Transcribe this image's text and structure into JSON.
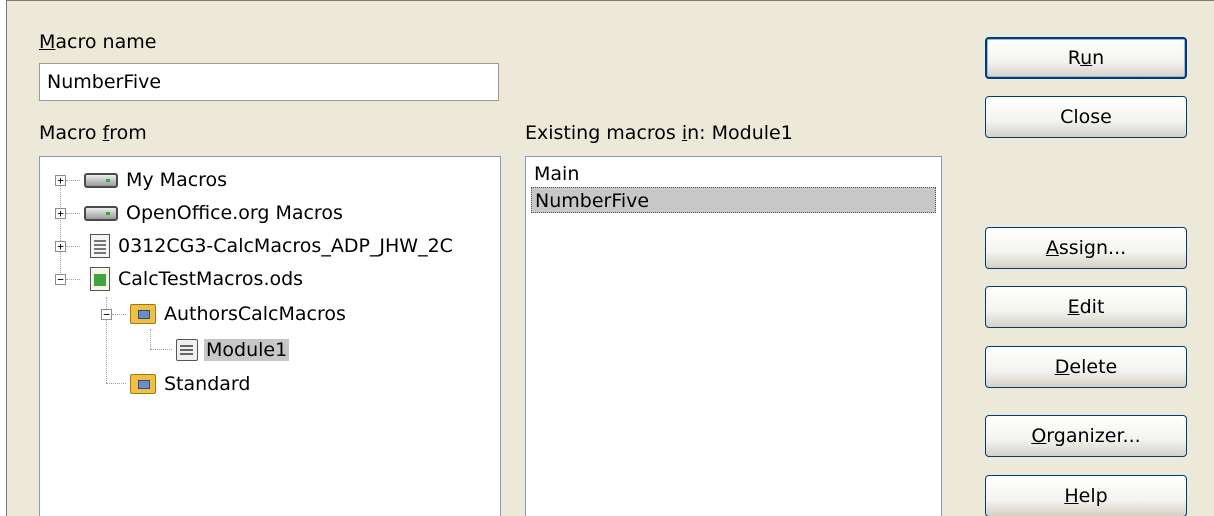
{
  "macro_name": {
    "label_key": "M",
    "label_rest": "acro name",
    "value": "NumberFive"
  },
  "macro_from": {
    "label_pre": "Macro ",
    "label_key": "f",
    "label_post": "rom",
    "tree": [
      {
        "label": "My Macros",
        "icon": "drive-icon",
        "expander": "+"
      },
      {
        "label": "OpenOffice.org Macros",
        "icon": "drive-icon",
        "expander": "+"
      },
      {
        "label": "0312CG3-CalcMacros_ADP_JHW_2C",
        "icon": "document-icon",
        "expander": "+"
      },
      {
        "label": "CalcTestMacros.ods",
        "icon": "spreadsheet-icon",
        "expander": "−"
      },
      {
        "label": "AuthorsCalcMacros",
        "icon": "library-folder-icon",
        "expander": "−"
      },
      {
        "label": "Module1",
        "icon": "module-icon",
        "selected": true
      },
      {
        "label": "Standard",
        "icon": "library-folder-icon"
      }
    ]
  },
  "existing_macros": {
    "label_pre": "Existing macros ",
    "label_key": "i",
    "label_post": "n: Module1",
    "items": [
      "Main",
      "NumberFive"
    ],
    "selected_index": 1
  },
  "buttons": {
    "run": {
      "pre": "R",
      "key": "u",
      "post": "n"
    },
    "close": {
      "label": "Close"
    },
    "assign": {
      "key": "A",
      "post": "ssign..."
    },
    "edit": {
      "key": "E",
      "post": "dit"
    },
    "delete": {
      "key": "D",
      "post": "elete"
    },
    "organizer": {
      "key": "O",
      "post": "rganizer..."
    },
    "help": {
      "key": "H",
      "post": "elp"
    }
  },
  "colors": {
    "dialog_bg": "#ece9d8",
    "selection": "#c7c7c7",
    "button_border": "#003c74"
  }
}
